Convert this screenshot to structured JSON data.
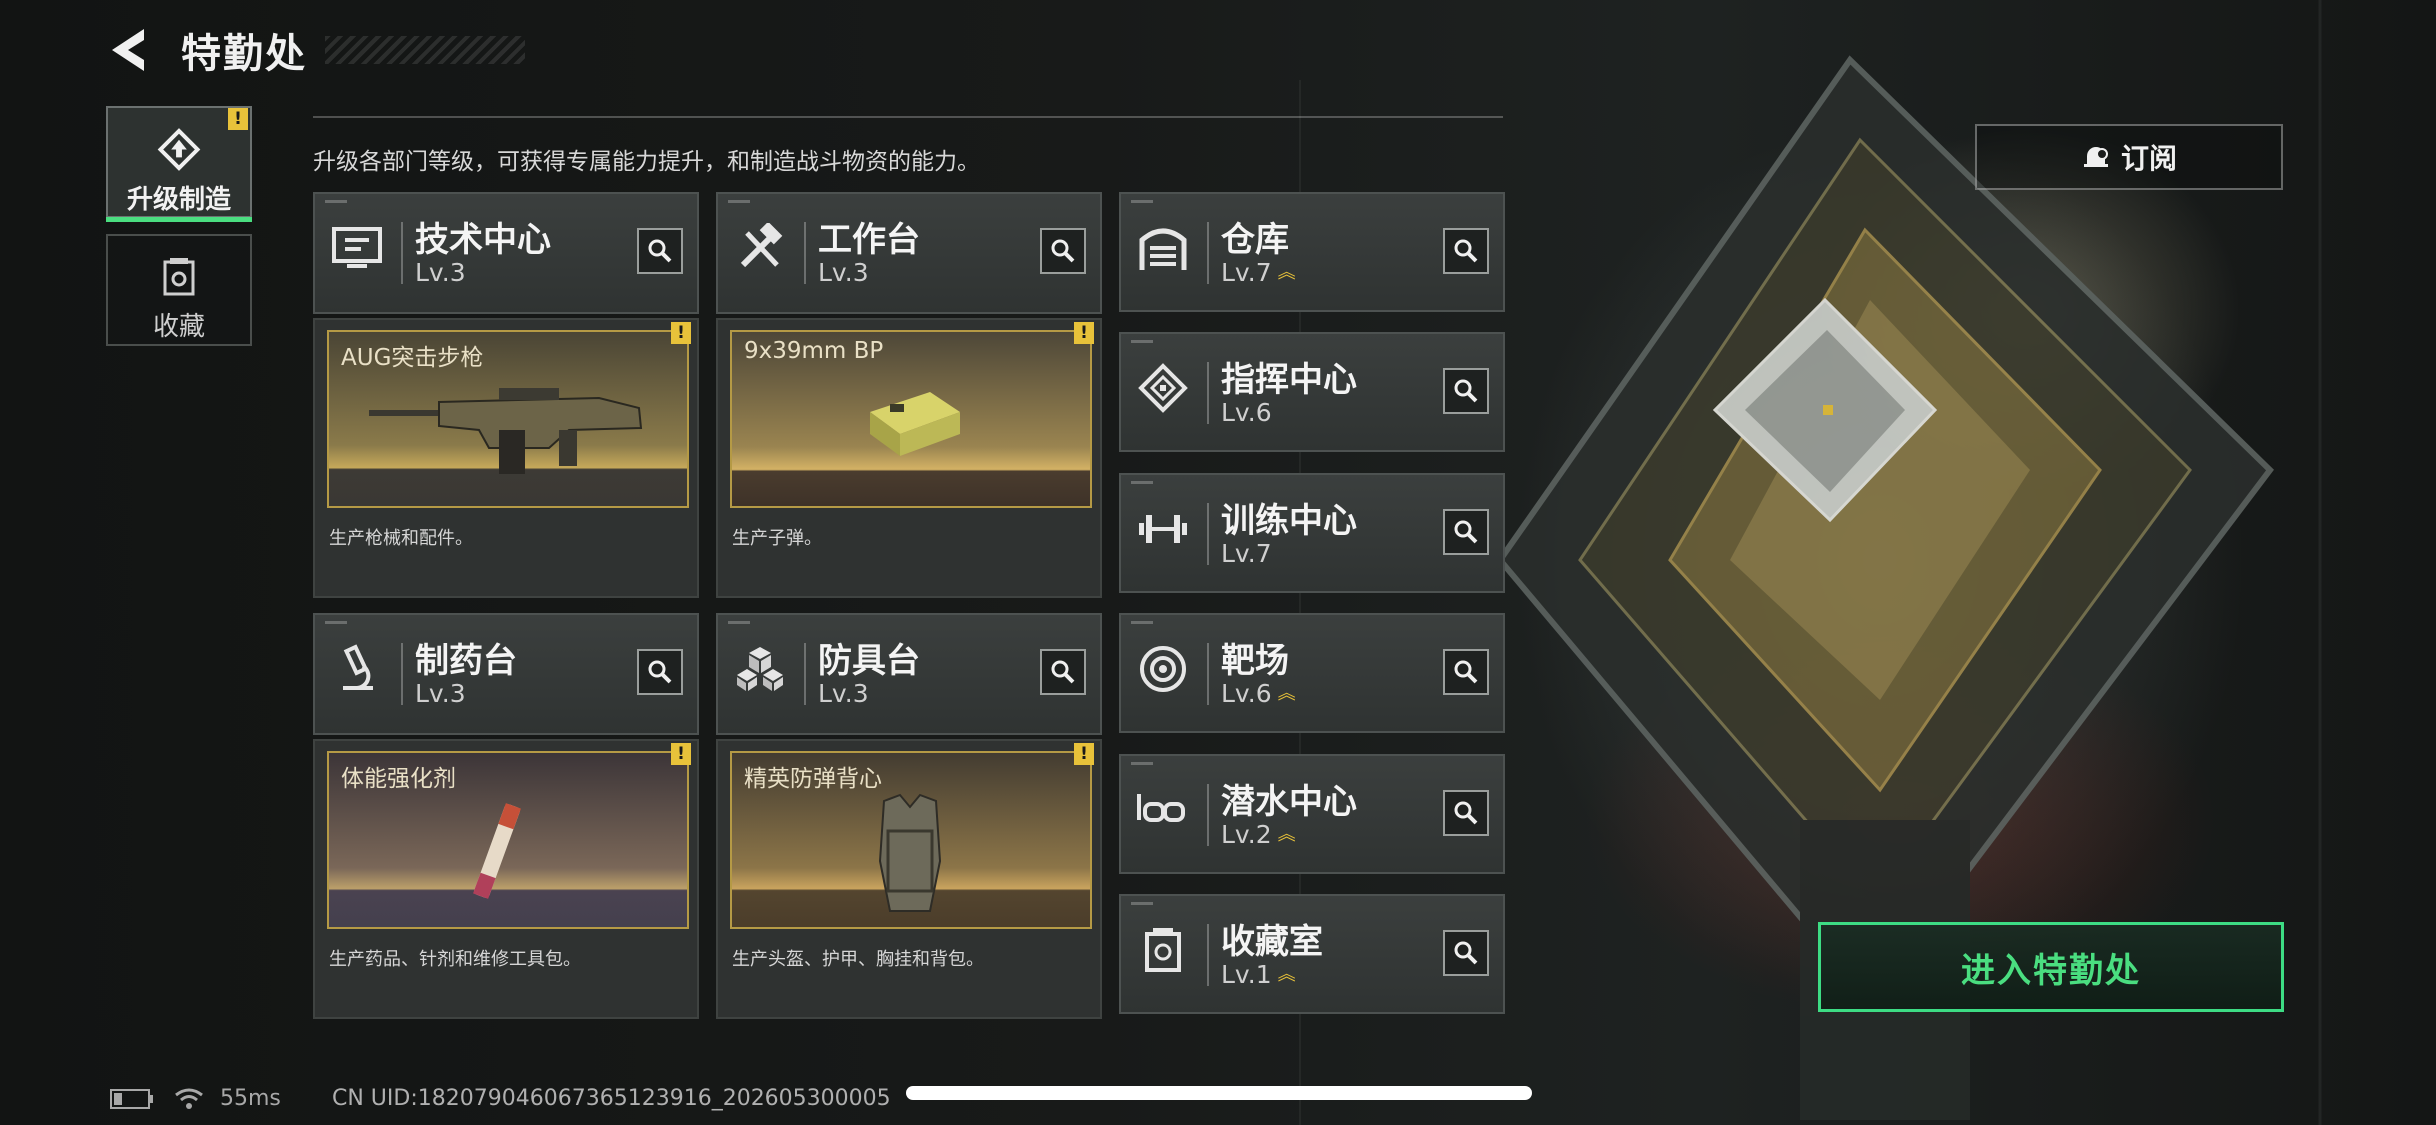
{
  "header": {
    "title": "特勤处"
  },
  "sidebar": {
    "tabs": [
      {
        "label": "升级制造",
        "active": true,
        "alert": "!"
      },
      {
        "label": "收藏",
        "active": false
      }
    ]
  },
  "subtitle": "升级各部门等级，可获得专属能力提升，和制造战斗物资的能力。",
  "departments": {
    "tech": {
      "name": "技术中心",
      "level": "Lv.3"
    },
    "workbench": {
      "name": "工作台",
      "level": "Lv.3"
    },
    "pharmacy": {
      "name": "制药台",
      "level": "Lv.3"
    },
    "armor": {
      "name": "防具台",
      "level": "Lv.3"
    },
    "warehouse": {
      "name": "仓库",
      "level": "Lv.7",
      "upgradable": true
    },
    "command": {
      "name": "指挥中心",
      "level": "Lv.6"
    },
    "training": {
      "name": "训练中心",
      "level": "Lv.7"
    },
    "range": {
      "name": "靶场",
      "level": "Lv.6",
      "upgradable": true
    },
    "diving": {
      "name": "潜水中心",
      "level": "Lv.2",
      "upgradable": true
    },
    "collection": {
      "name": "收藏室",
      "level": "Lv.1",
      "upgradable": true
    }
  },
  "products": {
    "tech": {
      "name": "AUG突击步枪",
      "desc": "生产枪械和配件。",
      "alert": "!"
    },
    "workbench": {
      "name": "9x39mm BP",
      "desc": "生产子弹。",
      "alert": "!"
    },
    "pharmacy": {
      "name": "体能强化剂",
      "desc": "生产药品、针剂和维修工具包。",
      "alert": "!"
    },
    "armor": {
      "name": "精英防弹背心",
      "desc": "生产头盔、护甲、胸挂和背包。",
      "alert": "!"
    }
  },
  "buttons": {
    "subscribe": "订阅",
    "enter": "进入特勤处"
  },
  "status": {
    "ping": "55ms",
    "uid": "CN UID:18207904606736512391​6_202605300005"
  },
  "colors": {
    "accent_green": "#4ade80",
    "alert_yellow": "#e8c23a",
    "frame_gold": "#b59a45"
  }
}
